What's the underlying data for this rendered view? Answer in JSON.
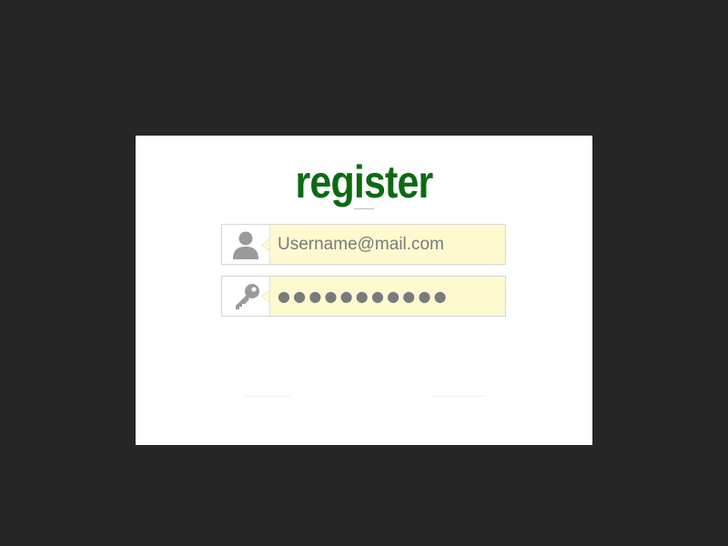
{
  "register": {
    "title": "register",
    "username_field": {
      "placeholder": "Username@mail.com",
      "icon": "user-icon"
    },
    "password_field": {
      "masked_value": "●●●●●●●●●●●",
      "icon": "key-icon"
    }
  },
  "colors": {
    "background": "#262626",
    "card": "#ffffff",
    "title": "#0b6a12",
    "field_background": "#fff9d0",
    "icon": "#9a9a9a"
  }
}
